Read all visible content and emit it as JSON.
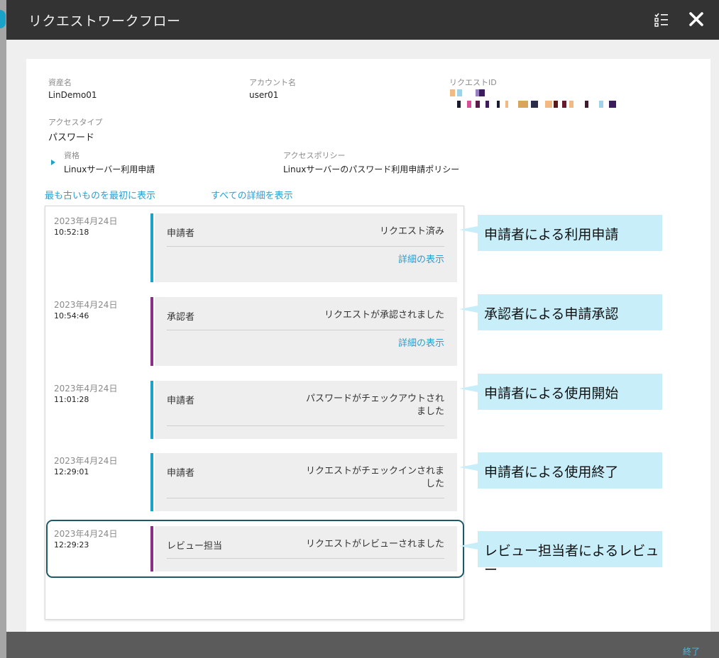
{
  "window": {
    "title": "リクエストワークフロー"
  },
  "asset": {
    "label": "資産名",
    "value": "LinDemo01"
  },
  "account": {
    "label": "アカウント名",
    "value": "user01"
  },
  "request_id": {
    "label": "リクエストID"
  },
  "access_type": {
    "label": "アクセスタイプ",
    "value": "パスワード"
  },
  "entitlement": {
    "label": "資格",
    "value": "Linuxサーバー利用申請"
  },
  "access_policy": {
    "label": "アクセスポリシー",
    "value": "Linuxサーバーのパスワード利用申請ポリシー"
  },
  "links": {
    "oldest_first": "最も古いものを最初に表示",
    "show_all_details": "すべての詳細を表示"
  },
  "events": [
    {
      "date": "2023年4月24日",
      "time": "10:52:18",
      "role": "申請者",
      "status": "リクエスト済み",
      "detail": "詳細の表示",
      "color": "#1aa3c8"
    },
    {
      "date": "2023年4月24日",
      "time": "10:54:46",
      "role": "承認者",
      "status": "リクエストが承認されました",
      "detail": "詳細の表示",
      "color": "#8b2f86"
    },
    {
      "date": "2023年4月24日",
      "time": "11:01:28",
      "role": "申請者",
      "status_line1": "パスワードがチェックアウトされ",
      "status_line2": "ました",
      "color": "#1aa3c8"
    },
    {
      "date": "2023年4月24日",
      "time": "12:29:01",
      "role": "申請者",
      "status_line1": "リクエストがチェックインされま",
      "status_line2": "した",
      "color": "#1aa3c8"
    },
    {
      "date": "2023年4月24日",
      "time": "12:29:23",
      "role": "レビュー担当",
      "status": "リクエストがレビューされました",
      "color": "#8b2f86"
    }
  ],
  "callouts": [
    "申請者による利用申請",
    "承認者による申請承認",
    "申請者による使用開始",
    "申請者による使用終了",
    "レビュー担当者によるレビュー"
  ],
  "footer": {
    "close_label": "終了"
  },
  "icons": {
    "list": "checklist-icon",
    "close": "close-icon"
  },
  "colors": {
    "accent": "#2b9fd1",
    "requester_bar": "#1aa3c8",
    "approver_bar": "#8b2f86",
    "callout_bg": "#c7eef9"
  }
}
